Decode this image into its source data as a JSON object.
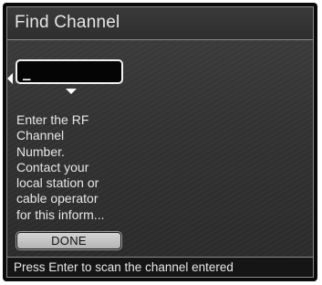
{
  "window": {
    "title": "Find Channel"
  },
  "channel_entry": {
    "value": "_"
  },
  "instructions": {
    "lines": [
      "Enter the RF",
      "Channel",
      "Number.",
      "Contact your",
      "local station or",
      "cable operator",
      "for this inform..."
    ]
  },
  "buttons": {
    "done_label": "DONE"
  },
  "status_bar": {
    "text": "Press Enter to scan the channel entered"
  },
  "icons": {
    "left": "left-arrow-icon",
    "down": "down-arrow-icon"
  },
  "colors": {
    "panel_background": "#333333",
    "border": "#8a8a8a",
    "text": "#e8e8e8",
    "button_face": "#c8c8c8"
  }
}
